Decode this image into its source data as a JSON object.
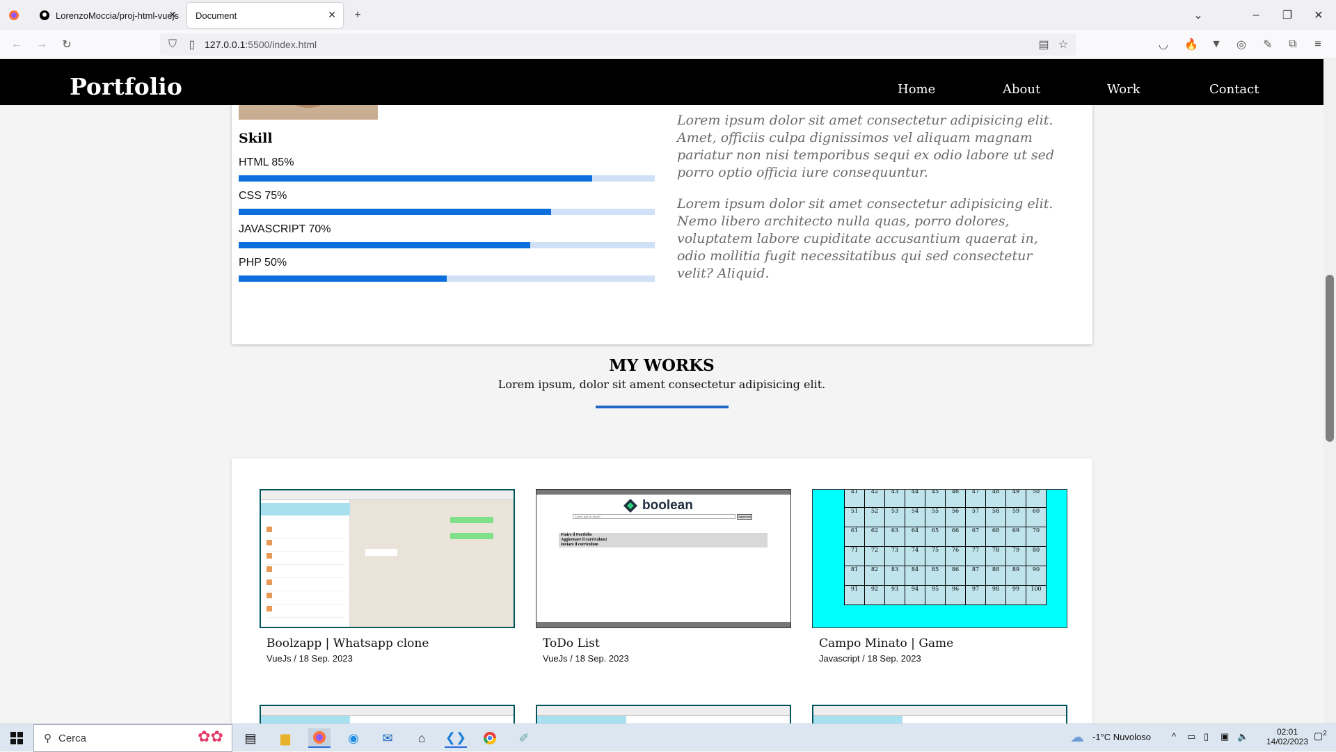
{
  "browser": {
    "tabs": [
      {
        "label": "LorenzoMoccia/proj-html-vuejs"
      },
      {
        "label": "Document"
      }
    ],
    "url_host": "127.0.0.1",
    "url_rest": ":5500/index.html"
  },
  "site": {
    "logo": "Portfolio",
    "nav": [
      "Home",
      "About",
      "Work",
      "Contact"
    ]
  },
  "about": {
    "skill_title": "Skill",
    "skills": [
      {
        "label": "HTML 85%",
        "percent": 85
      },
      {
        "label": "CSS 75%",
        "percent": 75
      },
      {
        "label": "JAVASCRIPT 70%",
        "percent": 70
      },
      {
        "label": "PHP 50%",
        "percent": 50
      }
    ],
    "paragraphs": [
      "Lorem ipsum dolor sit amet consectetur adipisicing elit. Amet, officiis culpa dignissimos vel aliquam magnam pariatur non nisi temporibus sequi ex odio labore ut sed porro optio officia iure consequuntur.",
      "Lorem ipsum dolor sit amet consectetur adipisicing elit. Nemo libero architecto nulla quas, porro dolores, voluptatem labore cupiditate accusantium quaerat in, odio mollitia fugit necessitatibus qui sed consectetur velit? Aliquid."
    ]
  },
  "works": {
    "title": "MY WORKS",
    "subtitle": "Lorem ipsum, dolor sit ament consectetur adipisicing elit.",
    "items": [
      {
        "title": "Boolzapp | Whatsapp clone",
        "meta": "VueJs / 18 Sep. 2023"
      },
      {
        "title": "ToDo List",
        "meta": "VueJs / 18 Sep. 2023"
      },
      {
        "title": "Campo Minato | Game",
        "meta": "Javascript / 18 Sep. 2023"
      }
    ],
    "todo_logo": "boolean",
    "todo_placeholder": "Scrivi qui le nuovi",
    "todo_button": "Aggiungi",
    "todo_items": [
      "Finire il Portfolio",
      "Aggiornare il curriculum!",
      "Inviare il curriculum"
    ],
    "grid_numbers": [
      [
        41,
        42,
        43,
        44,
        45,
        46,
        47,
        48,
        49,
        50
      ],
      [
        51,
        52,
        53,
        54,
        55,
        56,
        57,
        58,
        59,
        60
      ],
      [
        61,
        62,
        63,
        64,
        65,
        66,
        67,
        68,
        69,
        70
      ],
      [
        71,
        72,
        73,
        74,
        75,
        76,
        77,
        78,
        79,
        80
      ],
      [
        81,
        82,
        83,
        84,
        85,
        86,
        87,
        88,
        89,
        90
      ],
      [
        91,
        92,
        93,
        94,
        95,
        96,
        97,
        98,
        99,
        100
      ]
    ]
  },
  "taskbar": {
    "search_placeholder": "Cerca",
    "weather": "-1°C  Nuvoloso",
    "time": "02:01",
    "date": "14/02/2023",
    "notifications": "2"
  },
  "colors": {
    "accent": "#0c6fdb",
    "bar_track": "#cfe0f7",
    "header": "#000000",
    "minesweeper_bg": "#00ffff"
  }
}
